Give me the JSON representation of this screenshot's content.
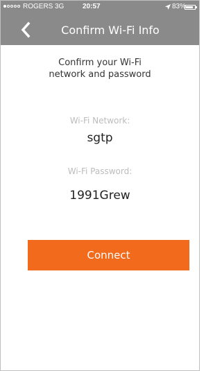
{
  "status_bar": {
    "carrier": "ROGERS",
    "network": "3G",
    "time": "20:57",
    "battery": "83%",
    "battery_level": 0.83,
    "icons": [
      "signal-dots-icon",
      "location-arrow-icon",
      "battery-icon"
    ]
  },
  "nav": {
    "back_icon": "chevron-left-icon",
    "title": "Confirm Wi-Fi Info"
  },
  "content": {
    "heading_line1": "Confirm your Wi-Fi",
    "heading_line2": "network and password",
    "network_label": "Wi-Fi Network:",
    "network_value": "sgtp",
    "password_label": "Wi-Fi Password:",
    "password_value": "1991Grew"
  },
  "actions": {
    "connect_label": "Connect"
  },
  "colors": {
    "header": "#8a8a8a",
    "accent": "#f26a1b",
    "label": "#bcbcbc"
  }
}
